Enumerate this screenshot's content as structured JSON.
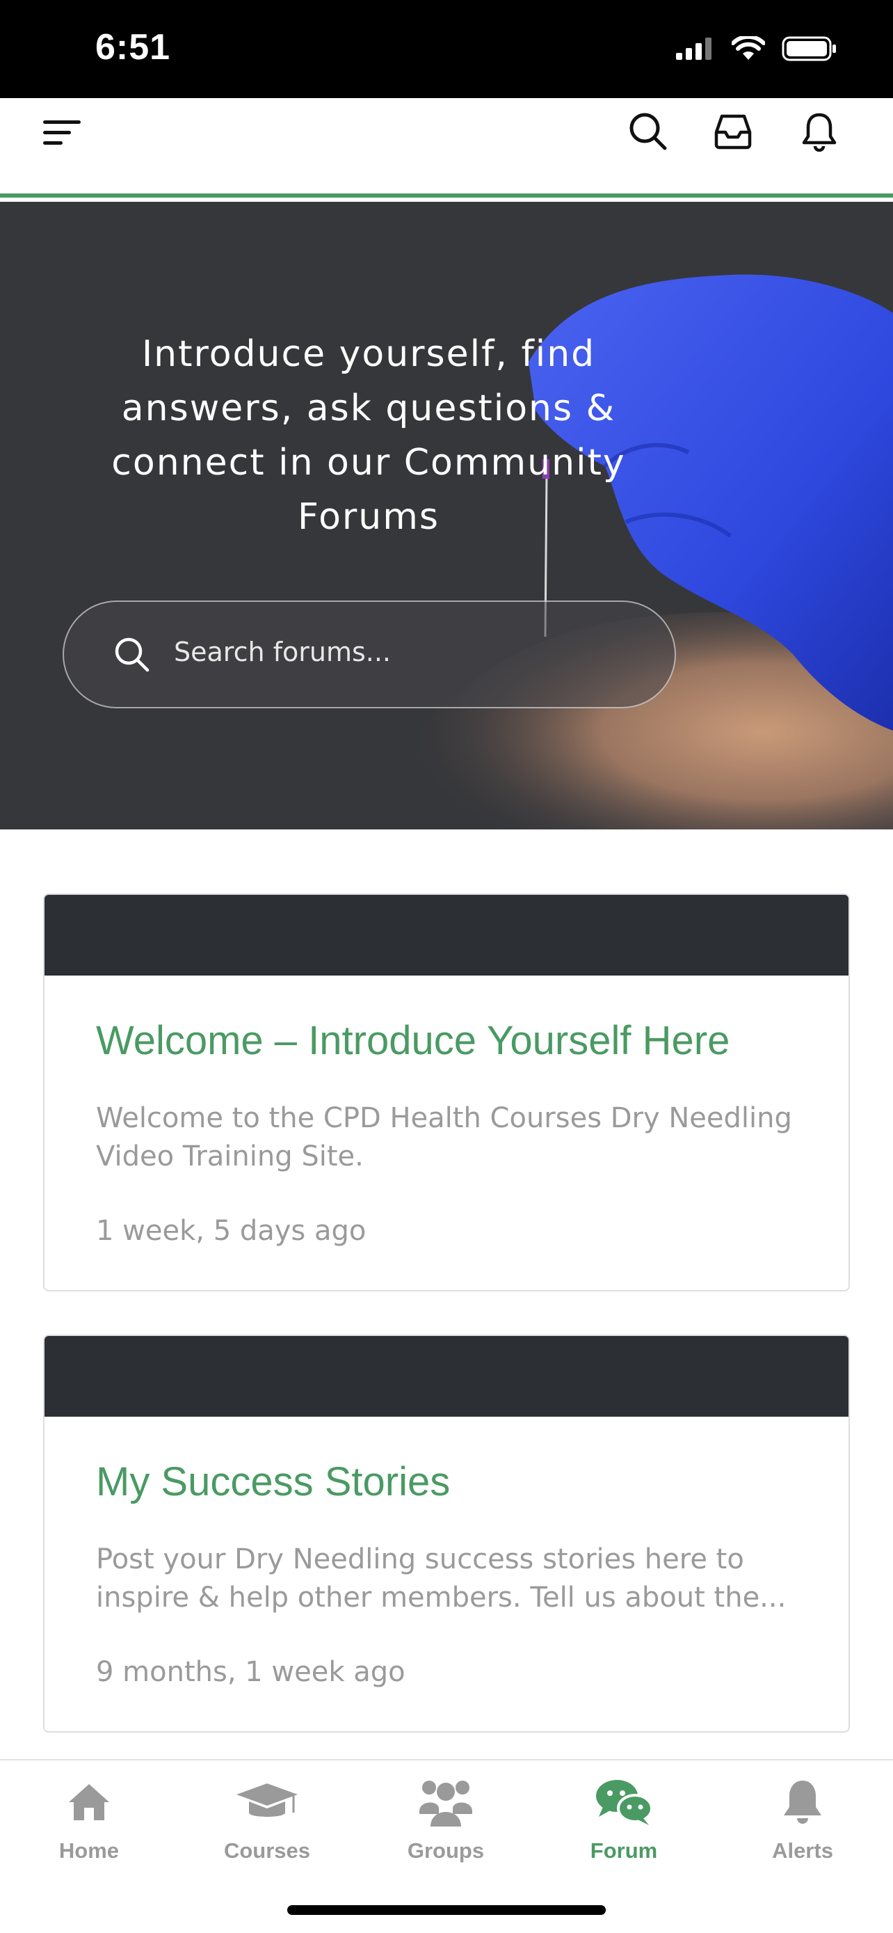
{
  "status_bar": {
    "time": "6:51",
    "icons": [
      "signal-icon",
      "wifi-icon",
      "battery-icon"
    ]
  },
  "header": {
    "icons": [
      "menu-icon",
      "search-icon",
      "inbox-icon",
      "bell-icon"
    ]
  },
  "hero": {
    "title": "Introduce yourself, find answers, ask questions & connect in our Community Forums",
    "search_placeholder": "Search forums..."
  },
  "forums": [
    {
      "title": "Welcome – Introduce Yourself Here",
      "description": "Welcome to the CPD Health Courses Dry Needling Video Training Site.",
      "last_activity": "1 week, 5 days ago"
    },
    {
      "title": "My Success Stories",
      "description": "Post your Dry Needling success stories here to inspire & help other members. Tell us about the...",
      "last_activity": "9 months, 1 week ago"
    }
  ],
  "tabs": [
    {
      "label": "Home",
      "icon": "home-icon",
      "active": false
    },
    {
      "label": "Courses",
      "icon": "graduation-cap-icon",
      "active": false
    },
    {
      "label": "Groups",
      "icon": "groups-icon",
      "active": false
    },
    {
      "label": "Forum",
      "icon": "chat-bubbles-icon",
      "active": true
    },
    {
      "label": "Alerts",
      "icon": "bell-icon",
      "active": false
    }
  ],
  "colors": {
    "accent": "#4a9a63",
    "card_banner": "#2c2f34",
    "hero_bg": "#36373b",
    "glove": "#2f49e0",
    "muted_text": "#9a9a9a"
  }
}
